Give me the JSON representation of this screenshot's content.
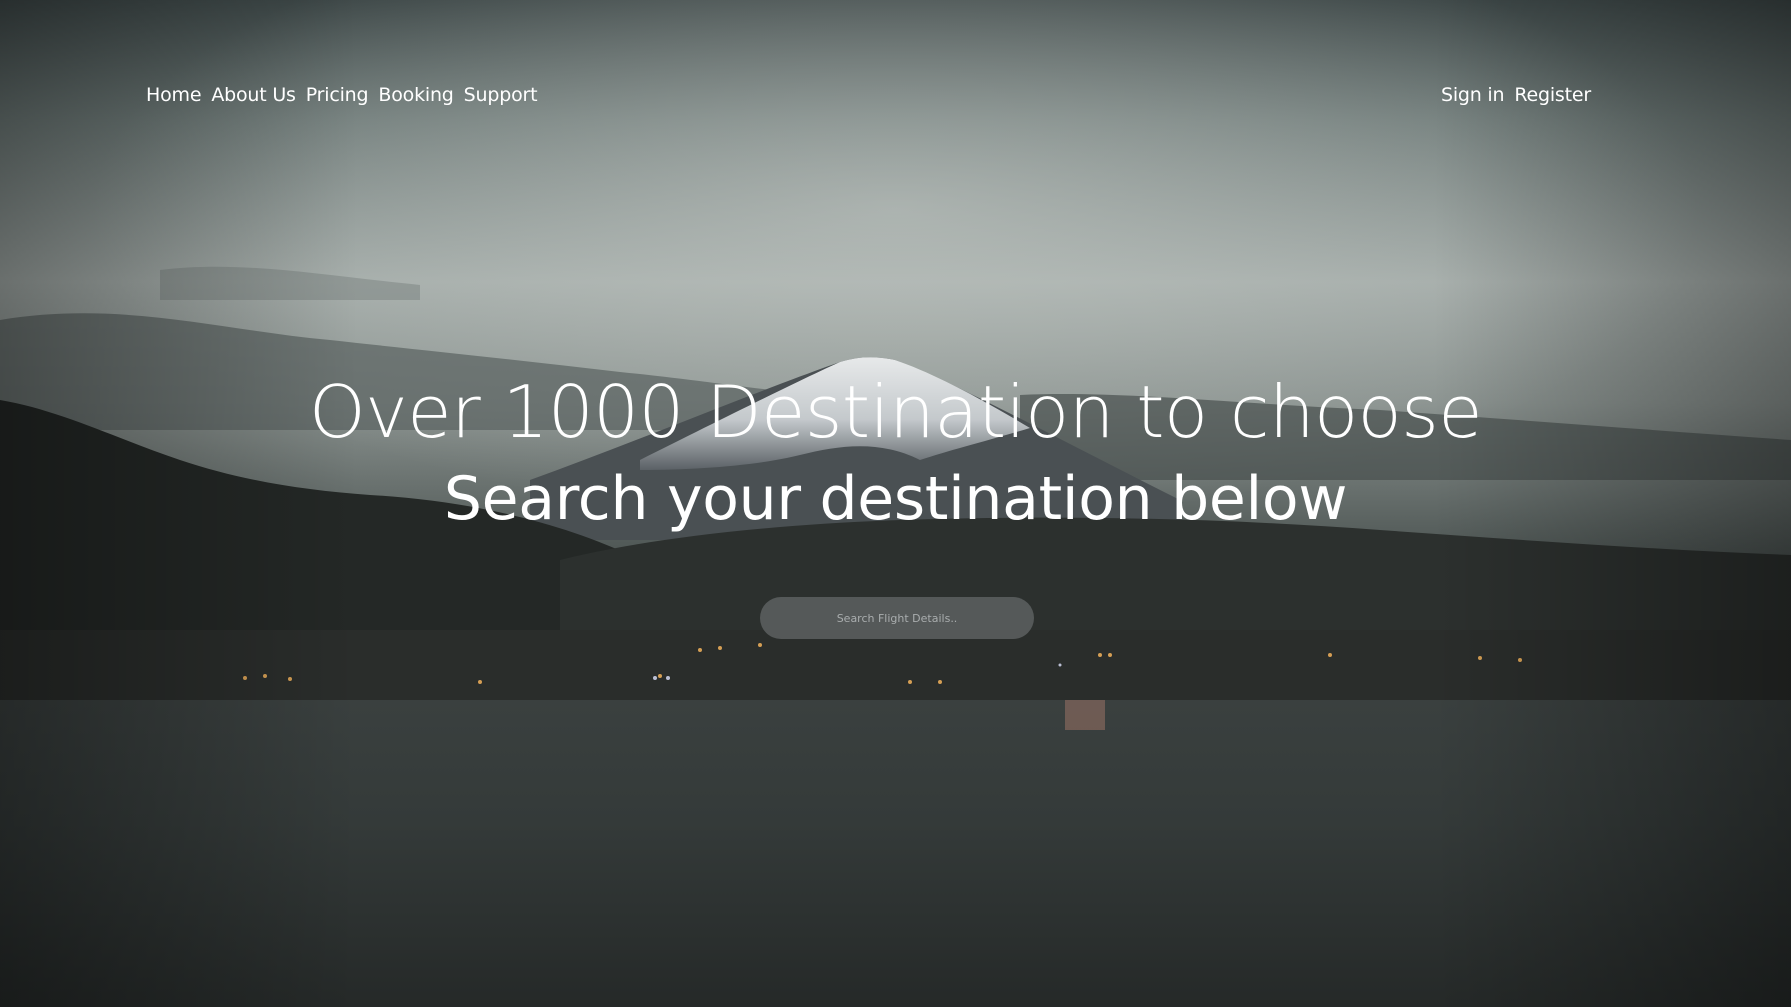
{
  "nav": {
    "left_items": [
      "Home",
      "About Us",
      "Pricing",
      "Booking",
      "Support"
    ],
    "right_items": [
      "Sign in",
      "Register"
    ]
  },
  "hero": {
    "headline": "Over 1000 Destination to choose",
    "subhead": "Search your destination below"
  },
  "search": {
    "placeholder": "Search Flight Details..",
    "value": ""
  },
  "colors": {
    "text": "#ffffff",
    "search_bg": "#787c7e"
  }
}
